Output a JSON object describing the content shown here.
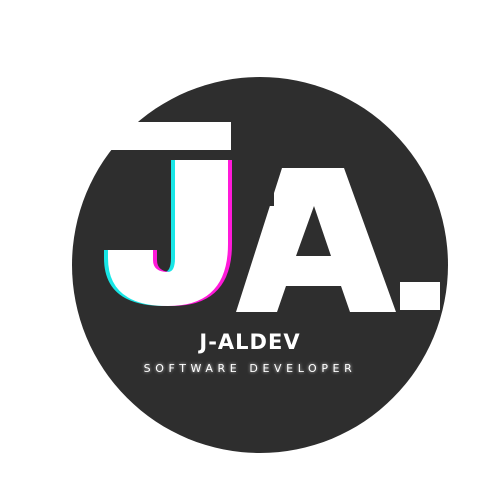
{
  "logo": {
    "monogram_letters": "JA",
    "brand_name": "J-ALDEV",
    "tagline": "SOFTWARE DEVELOPER",
    "colors": {
      "circle": "#2e2e2e",
      "foreground": "#ffffff",
      "glitch_cyan": "#18e6e6",
      "glitch_magenta": "#ff1ad9"
    }
  }
}
